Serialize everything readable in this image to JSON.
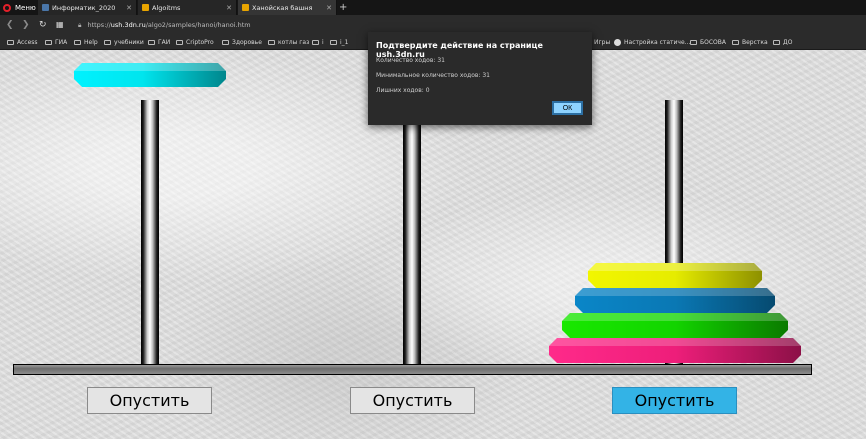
{
  "browser": {
    "menu_label": "Меню",
    "tabs": [
      {
        "title": "Информатик_2020",
        "favicon_color": "#4a76a8"
      },
      {
        "title": "Algoitms",
        "favicon_color": "#e8a400"
      },
      {
        "title": "Ханойская башня",
        "favicon_color": "#e8a400"
      }
    ],
    "new_tab": "+",
    "url_prefix": "https://",
    "url_domain": "ush.3dn.ru",
    "url_path": "/algo2/samples/hanoi/hanoi.htm",
    "bookmarks": [
      "Access",
      "ГИА",
      "Help",
      "учебники",
      "ГАИ",
      "CriptoPro",
      "Здоровье",
      "котлы газ",
      "i",
      "i_1"
    ],
    "bookmarks_right": [
      "Игры",
      "Настройка статиче...",
      "БОСОВА",
      "Верстка",
      "ДО"
    ]
  },
  "dialog": {
    "title": "Подтвердите действие на странице ush.3dn.ru",
    "moves": "Количество ходов: 31",
    "min_moves": "Минимальное количество ходов: 31",
    "extra_moves": "Лишних ходов: 0",
    "ok_label": "ОК"
  },
  "game": {
    "buttons": [
      "Опустить",
      "Опустить",
      "Опустить"
    ],
    "active_button": 2,
    "accent_color": "#33b3e6",
    "disks": [
      {
        "name": "cyan",
        "color": "#00e5ee",
        "rod": "held"
      },
      {
        "name": "yellow",
        "color": "#e8ee00",
        "rod": 3
      },
      {
        "name": "blue",
        "color": "#0a78b4",
        "rod": 3
      },
      {
        "name": "green",
        "color": "#12d400",
        "rod": 3
      },
      {
        "name": "pink",
        "color": "#ee1e7a",
        "rod": 3
      }
    ]
  }
}
